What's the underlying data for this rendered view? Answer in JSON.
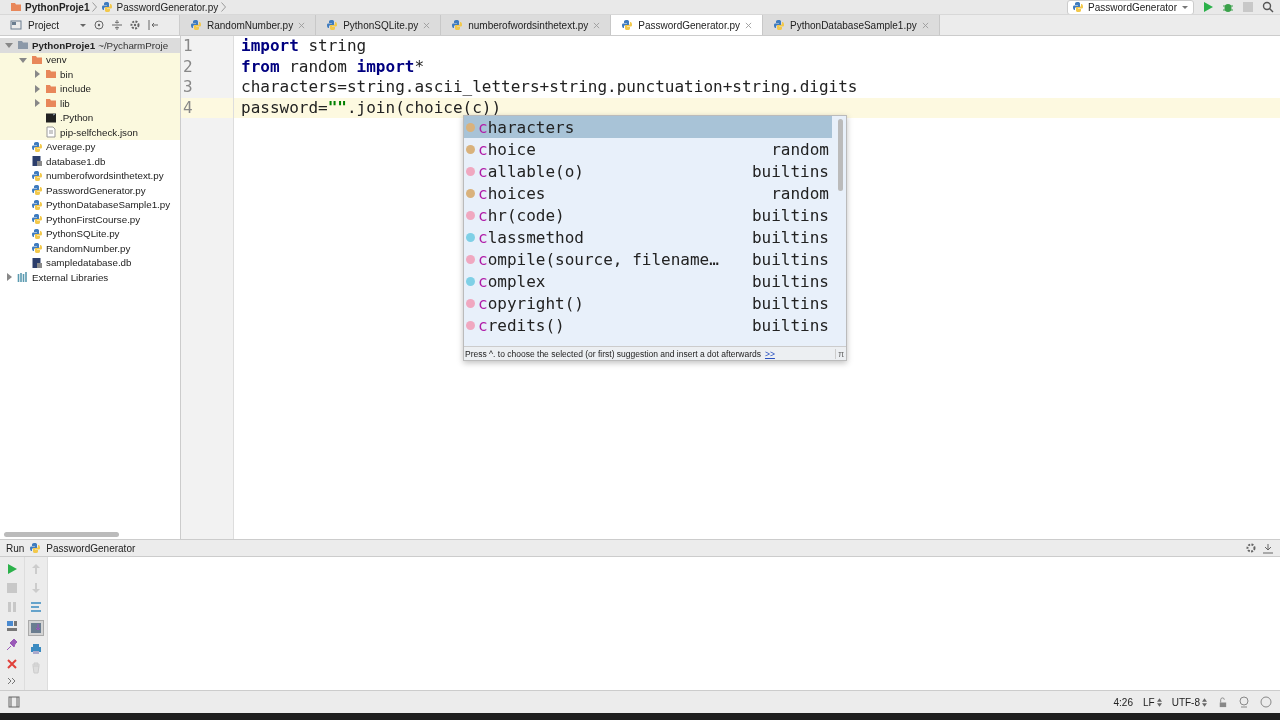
{
  "breadcrumb": [
    {
      "label": "PythonProje1",
      "kind": "folder"
    },
    {
      "label": "PasswordGenerator.py",
      "kind": "python"
    }
  ],
  "project_panel": {
    "title": "Project"
  },
  "tabs": [
    {
      "label": "RandomNumber.py",
      "selected": false
    },
    {
      "label": "PythonSQLite.py",
      "selected": false
    },
    {
      "label": "numberofwordsinthetext.py",
      "selected": false
    },
    {
      "label": "PasswordGenerator.py",
      "selected": true
    },
    {
      "label": "PythonDatabaseSample1.py",
      "selected": false
    }
  ],
  "run_config": {
    "label": "PasswordGenerator"
  },
  "tree": [
    {
      "label": "PythonProje1",
      "path": "~/PycharmProje",
      "kind": "project",
      "expanded": true,
      "children": [
        {
          "label": "venv",
          "kind": "folder",
          "expanded": true,
          "children": [
            {
              "label": "bin",
              "kind": "folder",
              "expanded": false
            },
            {
              "label": "include",
              "kind": "folder",
              "expanded": false
            },
            {
              "label": "lib",
              "kind": "folder",
              "expanded": false
            },
            {
              "label": ".Python",
              "kind": "exec"
            },
            {
              "label": "pip-selfcheck.json",
              "kind": "json"
            }
          ]
        },
        {
          "label": "Average.py",
          "kind": "python"
        },
        {
          "label": "database1.db",
          "kind": "db"
        },
        {
          "label": "numberofwordsinthetext.py",
          "kind": "python"
        },
        {
          "label": "PasswordGenerator.py",
          "kind": "python"
        },
        {
          "label": "PythonDatabaseSample1.py",
          "kind": "python"
        },
        {
          "label": "PythonFirstCourse.py",
          "kind": "python"
        },
        {
          "label": "PythonSQLite.py",
          "kind": "python"
        },
        {
          "label": "RandomNumber.py",
          "kind": "python"
        },
        {
          "label": "sampledatabase.db",
          "kind": "db"
        }
      ]
    },
    {
      "label": "External Libraries",
      "kind": "libraries",
      "expanded": false
    }
  ],
  "code": [
    {
      "number": "1",
      "current": false,
      "tokens": [
        {
          "text": "import",
          "kind": "keyword"
        },
        {
          "text": " string",
          "kind": "plain"
        }
      ]
    },
    {
      "number": "2",
      "current": false,
      "tokens": [
        {
          "text": "from",
          "kind": "keyword"
        },
        {
          "text": " random ",
          "kind": "plain"
        },
        {
          "text": "import",
          "kind": "keyword"
        },
        {
          "text": "*",
          "kind": "plain"
        }
      ]
    },
    {
      "number": "3",
      "current": false,
      "tokens": [
        {
          "text": "characters=string.ascii_letters+string.punctuation+string.digits",
          "kind": "plain"
        }
      ]
    },
    {
      "number": "4",
      "current": true,
      "tokens": [
        {
          "text": "password=",
          "kind": "plain"
        },
        {
          "text": "\"\"",
          "kind": "string"
        },
        {
          "text": ".join(choice(c))",
          "kind": "plain"
        }
      ]
    }
  ],
  "completion": {
    "items": [
      {
        "prefix": "c",
        "rest": "haracters",
        "kind": "v",
        "selected": true
      },
      {
        "prefix": "c",
        "rest": "hoice",
        "source": "random",
        "kind": "v",
        "selected": false
      },
      {
        "prefix": "c",
        "rest": "allable(o)",
        "source": "builtins",
        "kind": "f",
        "selected": false
      },
      {
        "prefix": "c",
        "rest": "hoices",
        "source": "random",
        "kind": "v",
        "selected": false
      },
      {
        "prefix": "c",
        "rest": "hr(code)",
        "source": "builtins",
        "kind": "f",
        "selected": false
      },
      {
        "prefix": "c",
        "rest": "lassmethod",
        "source": "builtins",
        "kind": "c",
        "selected": false
      },
      {
        "prefix": "c",
        "rest": "ompile(source, filename…",
        "source": "builtins",
        "kind": "f",
        "selected": false
      },
      {
        "prefix": "c",
        "rest": "omplex",
        "source": "builtins",
        "kind": "c",
        "selected": false
      },
      {
        "prefix": "c",
        "rest": "opyright()",
        "source": "builtins",
        "kind": "f",
        "selected": false
      },
      {
        "prefix": "c",
        "rest": "redits()",
        "source": "builtins",
        "kind": "f",
        "selected": false
      }
    ],
    "hint": "Press ^. to choose the selected (or first) suggestion and insert a dot afterwards",
    "hint_link": ">>",
    "pi": "π"
  },
  "run_panel": {
    "title": "Run",
    "config": "PasswordGenerator"
  },
  "status_bar": {
    "position": "4:26",
    "line_separator": "LF",
    "encoding": "UTF-8"
  }
}
